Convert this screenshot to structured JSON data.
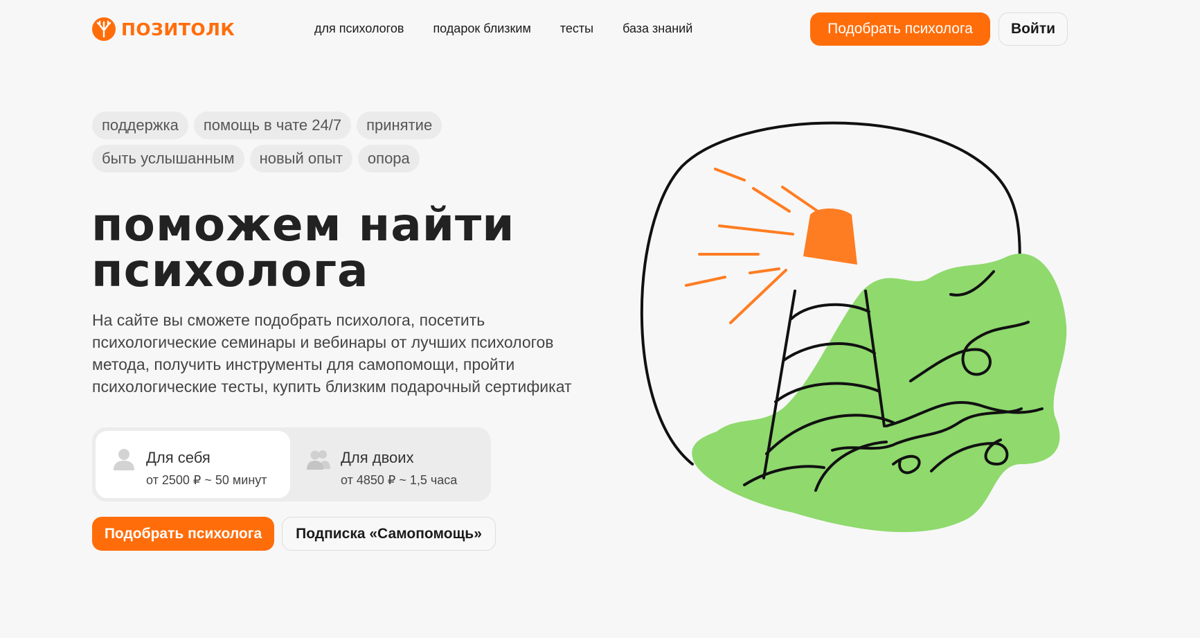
{
  "header": {
    "logo_text": "ПОЗИТОЛК",
    "nav": [
      "для психологов",
      "подарок близким",
      "тесты",
      "база знаний"
    ],
    "cta_label": "Подобрать психолога",
    "login_label": "Войти"
  },
  "tags": [
    "поддержка",
    "помощь в чате 24/7",
    "принятие",
    "быть услышанным",
    "новый опыт",
    "опора"
  ],
  "hero": {
    "title_line1": "поможем найти",
    "title_line2": "психолога",
    "description": "На сайте вы сможете подобрать психолога, посетить психологические семинары и вебинары от лучших психологов метода, получить инструменты для самопомощи, пройти психологические тесты, купить близким подарочный сертификат"
  },
  "plans": [
    {
      "name": "Для себя",
      "price": "от 2500 ₽ ~ 50 минут",
      "icon": "person-icon",
      "selected": true
    },
    {
      "name": "Для двоих",
      "price": "от 4850 ₽ ~ 1,5 часа",
      "icon": "couple-icon",
      "selected": false
    }
  ],
  "actions": {
    "primary": "Подобрать психолога",
    "secondary": "Подписка «Самопомощь»"
  },
  "colors": {
    "accent": "#ff6d0a",
    "green": "#8fd96d",
    "background": "#f7f7f7"
  }
}
